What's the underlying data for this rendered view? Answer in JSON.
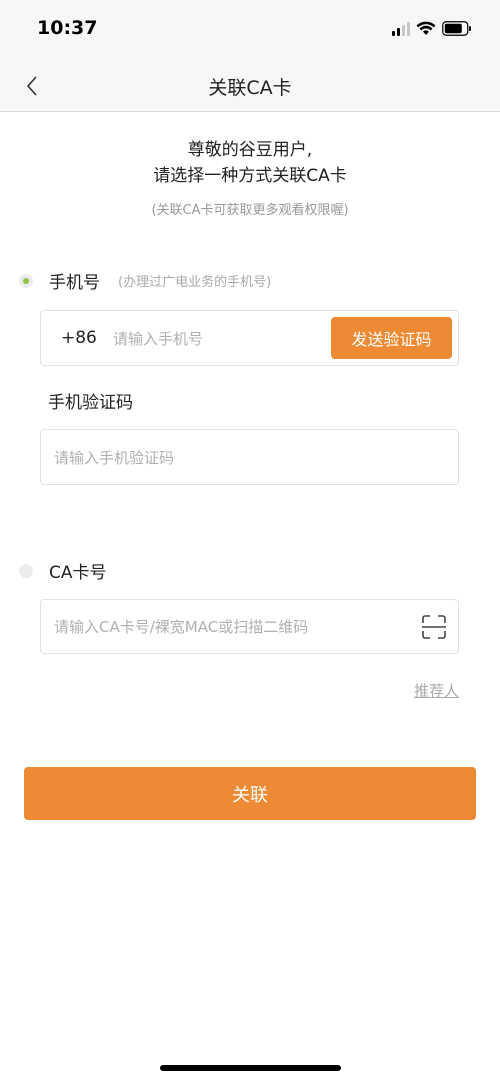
{
  "status_bar": {
    "time": "10:37"
  },
  "nav": {
    "title": "关联CA卡"
  },
  "greeting": {
    "line1": "尊敬的谷豆用户,",
    "line2": "请选择一种方式关联CA卡",
    "note": "(关联CA卡可获取更多观看权限喔)"
  },
  "phone_option": {
    "label": "手机号",
    "hint": "(办理过广电业务的手机号)",
    "selected": true,
    "country_code": "+86",
    "placeholder": "请输入手机号",
    "send_code_label": "发送验证码"
  },
  "code_field": {
    "label": "手机验证码",
    "placeholder": "请输入手机验证码"
  },
  "ca_option": {
    "label": "CA卡号",
    "selected": false,
    "placeholder": "请输入CA卡号/裸宽MAC或扫描二维码"
  },
  "referrer_link": "推荐人",
  "submit_label": "关联",
  "colors": {
    "accent": "#ee8a33",
    "radio_selected": "#8cc63f"
  }
}
